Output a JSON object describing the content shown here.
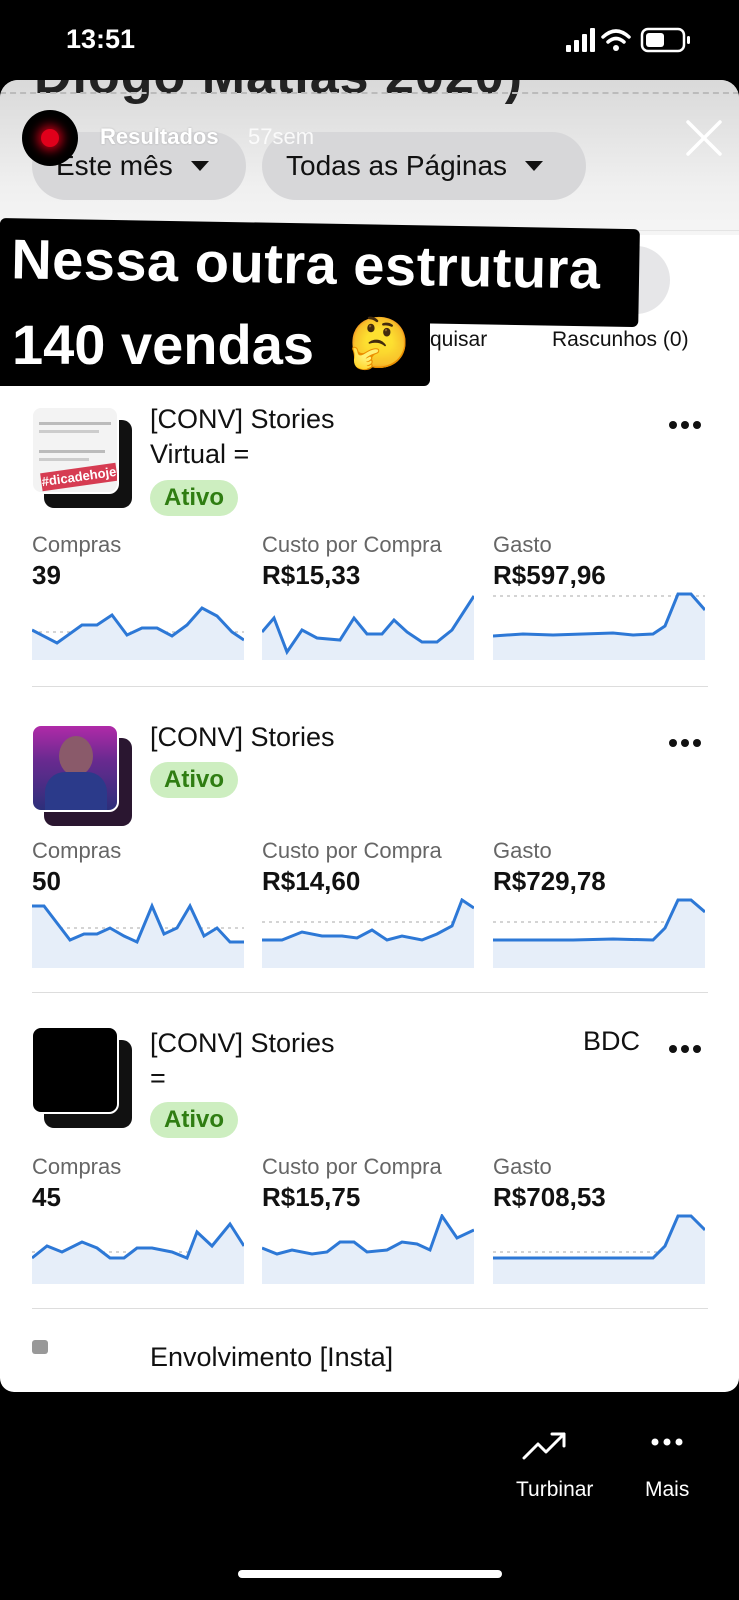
{
  "status": {
    "time": "13:51"
  },
  "header": {
    "cut_title": "Diogo Matias 2020)",
    "filter_period": "Este mês",
    "filter_pages": "Todas as Páginas"
  },
  "story": {
    "source": "Resultados",
    "age": "57sem"
  },
  "tabs": {
    "search": "quisar",
    "drafts": "Rascunhos (0)"
  },
  "caption": {
    "line1": "Nessa outra estrutura",
    "line2": "140 vendas",
    "emoji": "🤔"
  },
  "ads": [
    {
      "title_line1": "[CONV] Stories",
      "title_line2": "Virtual =",
      "extra": "",
      "status": "Ativo",
      "thumb_tag": "#dicadehoje",
      "metrics": [
        {
          "label": "Compras",
          "value": "39"
        },
        {
          "label": "Custo por Compra",
          "value": "R$15,33"
        },
        {
          "label": "Gasto",
          "value": "R$597,96"
        }
      ]
    },
    {
      "title_line1": "[CONV] Stories",
      "title_line2": "",
      "extra": "",
      "status": "Ativo",
      "metrics": [
        {
          "label": "Compras",
          "value": "50"
        },
        {
          "label": "Custo por Compra",
          "value": "R$14,60"
        },
        {
          "label": "Gasto",
          "value": "R$729,78"
        }
      ]
    },
    {
      "title_line1": "[CONV] Stories",
      "title_line2": "=",
      "extra": "BDC",
      "status": "Ativo",
      "metrics": [
        {
          "label": "Compras",
          "value": "45"
        },
        {
          "label": "Custo por Compra",
          "value": "R$15,75"
        },
        {
          "label": "Gasto",
          "value": "R$708,53"
        }
      ]
    }
  ],
  "next_ad": {
    "title": "Envolvimento [Insta]"
  },
  "bottom_nav": {
    "boost": "Turbinar",
    "more": "Mais"
  },
  "colors": {
    "accent_line": "#2d78d6",
    "badge_bg": "#cdeec0",
    "badge_text": "#2f7d12"
  }
}
